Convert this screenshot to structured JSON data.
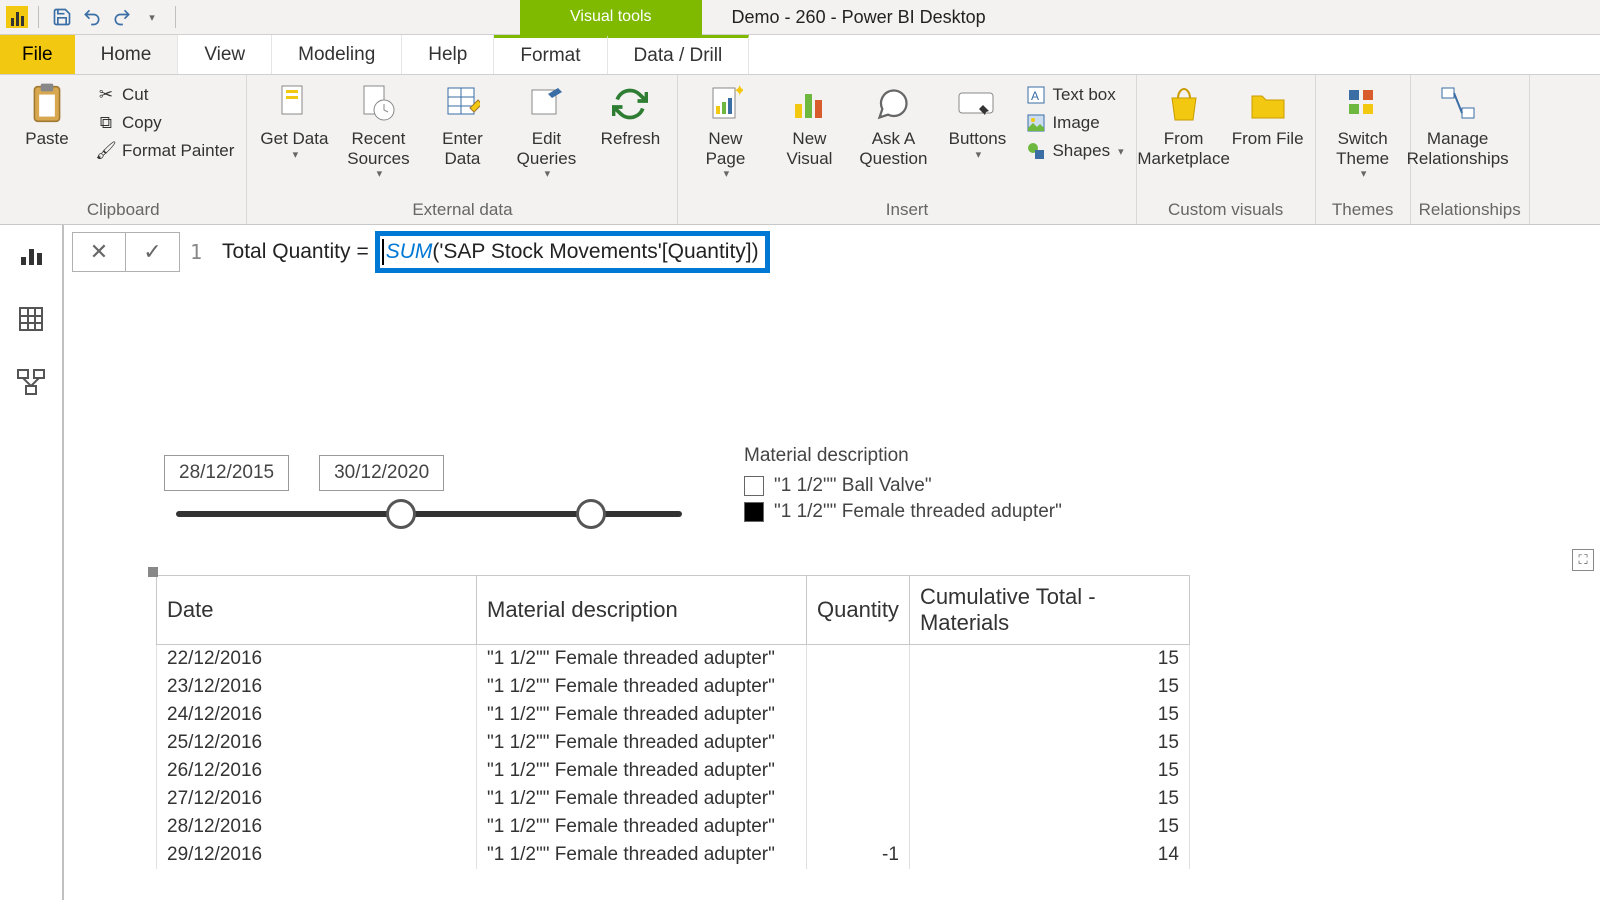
{
  "title": "Demo - 260 - Power BI Desktop",
  "contextual_tab": "Visual tools",
  "tabs": {
    "file": "File",
    "home": "Home",
    "view": "View",
    "modeling": "Modeling",
    "help": "Help",
    "format": "Format",
    "datadrill": "Data / Drill"
  },
  "ribbon": {
    "clipboard": {
      "label": "Clipboard",
      "paste": "Paste",
      "cut": "Cut",
      "copy": "Copy",
      "fp": "Format Painter"
    },
    "external": {
      "label": "External data",
      "getdata": "Get Data",
      "recent": "Recent Sources",
      "enter": "Enter Data",
      "edit": "Edit Queries",
      "refresh": "Refresh"
    },
    "insert": {
      "label": "Insert",
      "newpage": "New Page",
      "newvisual": "New Visual",
      "ask": "Ask A Question",
      "buttons": "Buttons",
      "textbox": "Text box",
      "image": "Image",
      "shapes": "Shapes"
    },
    "custom": {
      "label": "Custom visuals",
      "market": "From Marketplace",
      "file": "From File"
    },
    "themes": {
      "label": "Themes",
      "switch": "Switch Theme"
    },
    "rel": {
      "label": "Relationships",
      "manage": "Manage Relationships"
    }
  },
  "formula": {
    "line": "1",
    "measure_name": "Total Quantity",
    "eq": "=",
    "fn": "SUM",
    "body": "('SAP Stock Movements'[Quantity])"
  },
  "slicer": {
    "start": "28/12/2015",
    "end": "30/12/2020"
  },
  "legend": {
    "title": "Material description",
    "item1": "\"1 1/2\"\" Ball Valve\"",
    "item2": "\"1 1/2\"\" Female threaded adupter\""
  },
  "table": {
    "headers": {
      "date": "Date",
      "mat": "Material description",
      "qty": "Quantity",
      "cum": "Cumulative Total - Materials"
    },
    "rows": [
      {
        "date": "22/12/2016",
        "mat": "\"1 1/2\"\" Female threaded adupter\"",
        "qty": "",
        "cum": "15"
      },
      {
        "date": "23/12/2016",
        "mat": "\"1 1/2\"\" Female threaded adupter\"",
        "qty": "",
        "cum": "15"
      },
      {
        "date": "24/12/2016",
        "mat": "\"1 1/2\"\" Female threaded adupter\"",
        "qty": "",
        "cum": "15"
      },
      {
        "date": "25/12/2016",
        "mat": "\"1 1/2\"\" Female threaded adupter\"",
        "qty": "",
        "cum": "15"
      },
      {
        "date": "26/12/2016",
        "mat": "\"1 1/2\"\" Female threaded adupter\"",
        "qty": "",
        "cum": "15"
      },
      {
        "date": "27/12/2016",
        "mat": "\"1 1/2\"\" Female threaded adupter\"",
        "qty": "",
        "cum": "15"
      },
      {
        "date": "28/12/2016",
        "mat": "\"1 1/2\"\" Female threaded adupter\"",
        "qty": "",
        "cum": "15"
      },
      {
        "date": "29/12/2016",
        "mat": "\"1 1/2\"\" Female threaded adupter\"",
        "qty": "-1",
        "cum": "14"
      }
    ]
  }
}
